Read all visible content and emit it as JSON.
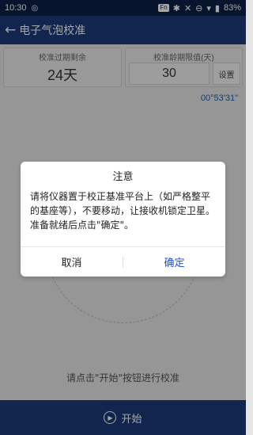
{
  "status_bar": {
    "time": "10:30",
    "left_icon": "cast-icon",
    "nfc": "Fn",
    "battery_text": "83%"
  },
  "app_bar": {
    "title": "电子气泡校准"
  },
  "cards": {
    "left_label": "校准过期剩余",
    "left_value": "24天",
    "right_label": "校准龄期限值(天)",
    "right_value": "30",
    "set_button": "设置"
  },
  "timecode": "00°53'31\"",
  "hint": "请点击\"开始\"按钮进行校准",
  "bottom": {
    "start_label": "开始"
  },
  "dialog": {
    "title": "注意",
    "message": "请将仪器置于校正基准平台上（如严格整平的基座等），不要移动，让接收机锁定卫星。准备就绪后点击\"确定\"。",
    "cancel": "取消",
    "ok": "确定"
  },
  "colors": {
    "app_bar": "#1b3a78",
    "accent": "#1f4fd0"
  }
}
